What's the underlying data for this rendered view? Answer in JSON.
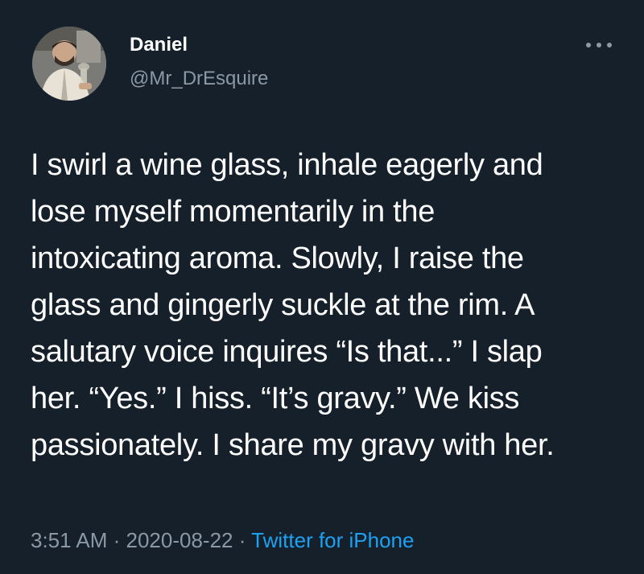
{
  "tweet": {
    "author": {
      "display_name": "Daniel",
      "handle": "@Mr_DrEsquire",
      "avatar_icon": "user-avatar-icon"
    },
    "more_icon": "more-options-icon",
    "text_lines": [
      "I swirl a wine glass, inhale eagerly and",
      "lose myself momentarily in the",
      "intoxicating aroma. Slowly, I raise the",
      "glass and gingerly suckle at the rim. A",
      "salutary voice inquires “Is that...” I slap",
      "her. “Yes.” I hiss. “It’s gravy.” We kiss",
      "passionately. I share my gravy with her."
    ],
    "meta": {
      "time": "3:51 AM",
      "separator": " · ",
      "date": "2020-08-22",
      "source": "Twitter for iPhone"
    }
  },
  "colors": {
    "background": "#15202b",
    "text": "#ffffff",
    "secondary": "#8b98a5",
    "link": "#1da1f2"
  }
}
